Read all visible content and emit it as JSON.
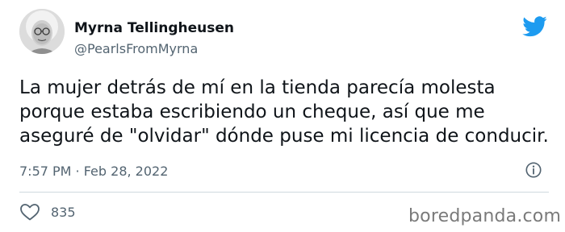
{
  "author": {
    "name": "Myrna Tellingheusen",
    "handle": "@PearlsFromMyrna",
    "avatar_icon": "elderly-woman-avatar"
  },
  "brand": {
    "icon": "twitter-bird-icon",
    "color": "#1d9bf0"
  },
  "tweet": {
    "lines": [
      "La mujer detrás de mí en la tienda parecía molesta",
      "porque estaba escribiendo un cheque, así que me",
      "aseguré de \"olvidar\" dónde puse mi licencia de conducir."
    ]
  },
  "meta": {
    "timestamp": "7:57 PM · Feb 28, 2022",
    "info_icon": "info-icon"
  },
  "engagement": {
    "like_icon": "heart-icon",
    "likes": "835"
  },
  "watermark": {
    "text": "boredpanda.com"
  }
}
